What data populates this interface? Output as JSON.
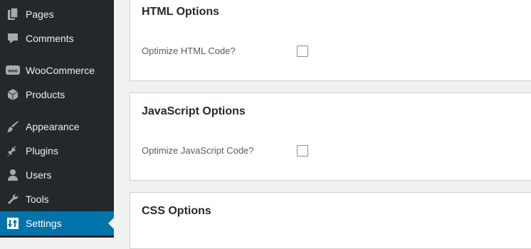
{
  "sidebar": {
    "items": [
      {
        "label": "Pages",
        "icon": "pages-icon"
      },
      {
        "label": "Comments",
        "icon": "comments-icon"
      },
      {
        "label": "WooCommerce",
        "icon": "woocommerce-icon"
      },
      {
        "label": "Products",
        "icon": "products-icon"
      },
      {
        "label": "Appearance",
        "icon": "appearance-icon"
      },
      {
        "label": "Plugins",
        "icon": "plugins-icon"
      },
      {
        "label": "Users",
        "icon": "users-icon"
      },
      {
        "label": "Tools",
        "icon": "tools-icon"
      },
      {
        "label": "Settings",
        "icon": "settings-icon",
        "active": true
      }
    ],
    "woo_badge": "woo"
  },
  "sections": {
    "html": {
      "title": "HTML Options",
      "option_label": "Optimize HTML Code?",
      "checked": false
    },
    "javascript": {
      "title": "JavaScript Options",
      "option_label": "Optimize JavaScript Code?",
      "checked": false
    },
    "css": {
      "title": "CSS Options"
    }
  },
  "colors": {
    "sidebar_bg": "#23282d",
    "active_bg": "#0073aa",
    "page_bg": "#f1f1f1"
  }
}
